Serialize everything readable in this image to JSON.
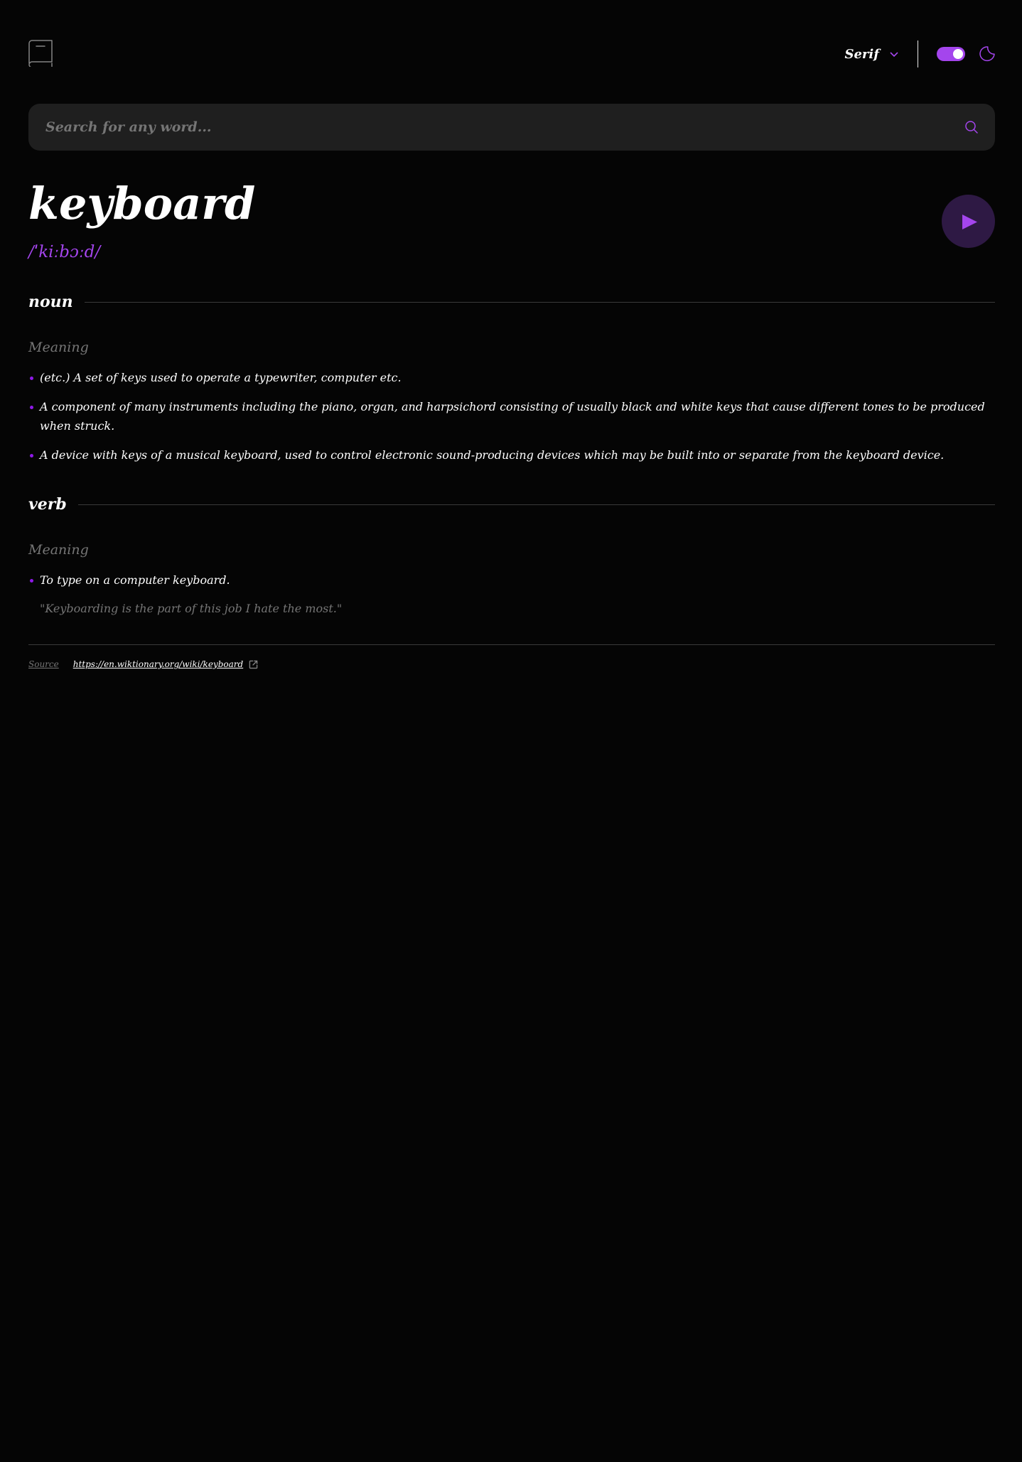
{
  "header": {
    "logo_icon": "book-icon",
    "font_selector": {
      "label": "Serif",
      "icon": "chevron-down-icon"
    },
    "theme_toggle": {
      "state": "on",
      "icon": "moon-icon"
    }
  },
  "search": {
    "placeholder": "Search for any word...",
    "value": "",
    "icon": "search-icon"
  },
  "entry": {
    "word": "keyboard",
    "phonetic": "/ˈkiːbɔːd/",
    "play_icon": "play-icon",
    "meanings": [
      {
        "part_of_speech": "noun",
        "heading": "Meaning",
        "definitions": [
          "(etc.) A set of keys used to operate a typewriter, computer etc.",
          "A component of many instruments including the piano, organ, and harpsichord consisting of usually black and white keys that cause different tones to be produced when struck.",
          "A device with keys of a musical keyboard, used to control electronic sound-producing devices which may be built into or separate from the keyboard device."
        ]
      },
      {
        "part_of_speech": "verb",
        "heading": "Meaning",
        "definitions": [
          "To type on a computer keyboard."
        ],
        "example": "\"Keyboarding is the part of this job I hate the most.\""
      }
    ]
  },
  "source": {
    "label": "Source",
    "url": "https://en.wiktionary.org/wiki/keyboard",
    "icon": "external-link-icon"
  },
  "colors": {
    "background": "#050505",
    "accent": "#a445ed",
    "muted": "#757575",
    "search_bg": "#1f1f1f",
    "play_bg": "#2e1944"
  }
}
